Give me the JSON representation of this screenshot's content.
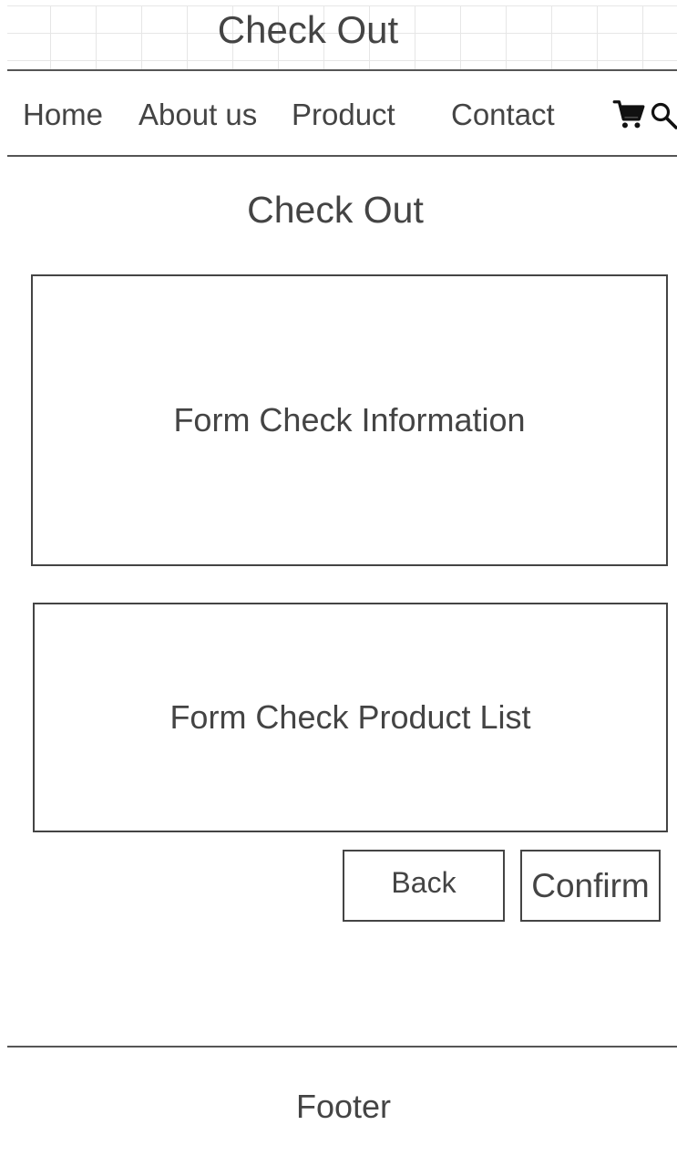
{
  "header": {
    "title": "Check Out"
  },
  "nav": {
    "items": [
      {
        "label": "Home"
      },
      {
        "label": "About us"
      },
      {
        "label": "Product"
      },
      {
        "label": "Contact"
      }
    ],
    "icons": [
      "cart-icon",
      "search-icon"
    ]
  },
  "main": {
    "heading": "Check Out",
    "info_form": {
      "label": "Form Check Information"
    },
    "product_list_form": {
      "label": "Form Check Product List"
    },
    "back_label": "Back",
    "confirm_label": "Confirm"
  },
  "footer": {
    "label": "Footer"
  }
}
